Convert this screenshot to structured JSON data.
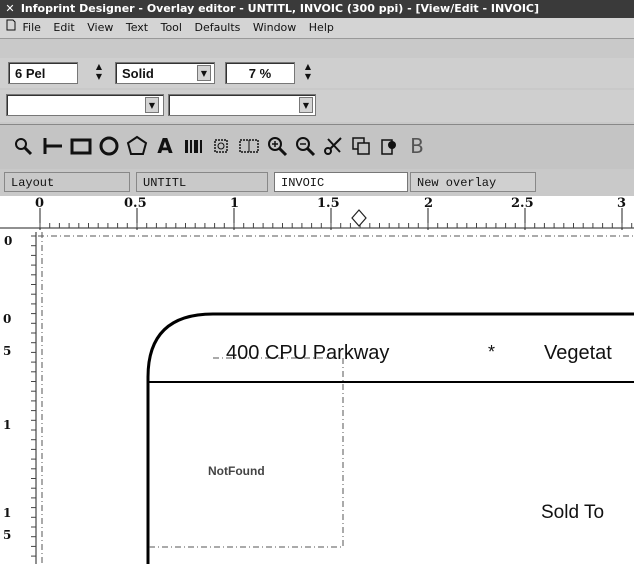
{
  "titlebar": {
    "title": "Infoprint Designer - Overlay editor - UNTITL, INVOIC (300 ppi) - [View/Edit - INVOIC]",
    "icon": "app-icon"
  },
  "menu": {
    "icon": "document-icon",
    "items": [
      "File",
      "Edit",
      "View",
      "Text",
      "Tool",
      "Defaults",
      "Window",
      "Help"
    ]
  },
  "props": {
    "line_width": "6 Pel",
    "line_style": "Solid",
    "shade": "7 %",
    "dropdown1": "",
    "dropdown2": ""
  },
  "tools": [
    {
      "name": "select-tool",
      "icon": "pointer-icon"
    },
    {
      "name": "line-tool",
      "icon": "line-icon"
    },
    {
      "name": "rectangle-tool",
      "icon": "rectangle-icon"
    },
    {
      "name": "circle-tool",
      "icon": "circle-icon"
    },
    {
      "name": "polygon-tool",
      "icon": "polygon-icon"
    },
    {
      "name": "text-tool",
      "icon": "text-icon"
    },
    {
      "name": "barcode-tool",
      "icon": "barcode-icon"
    },
    {
      "name": "image-tool",
      "icon": "image-icon"
    },
    {
      "name": "area-tool",
      "icon": "area-icon"
    },
    {
      "name": "zoom-in-tool",
      "icon": "zoom-in-icon"
    },
    {
      "name": "zoom-out-tool",
      "icon": "zoom-out-icon"
    },
    {
      "name": "cut-tool",
      "icon": "scissors-icon"
    },
    {
      "name": "copy-tool",
      "icon": "copy-icon"
    },
    {
      "name": "paste-tool",
      "icon": "paste-icon"
    },
    {
      "name": "b-tool",
      "icon": "b-icon"
    }
  ],
  "status": {
    "mode": "Layout",
    "form_def": "UNTITL",
    "overlay_name": "INVOIC",
    "state": "New overlay"
  },
  "ruler": {
    "h_labels": [
      "0",
      "0.5",
      "1",
      "1.5",
      "2",
      "2.5",
      "3"
    ],
    "v_labels": [
      {
        "text": "0"
      },
      {
        "text": "0"
      },
      {
        "text": "5"
      },
      {
        "text": "1"
      },
      {
        "text": "1"
      },
      {
        "text": "5"
      }
    ]
  },
  "canvas": {
    "address": "400 CPU Parkway",
    "bullet": "*",
    "company": "Vegetat",
    "image_placeholder": "NotFound",
    "sold_to": "Sold To"
  },
  "colors": {
    "titlebar_bg": "#3a3a3a",
    "toolbar_bg": "#cfcfcf",
    "canvas_bg": "#ffffff"
  }
}
